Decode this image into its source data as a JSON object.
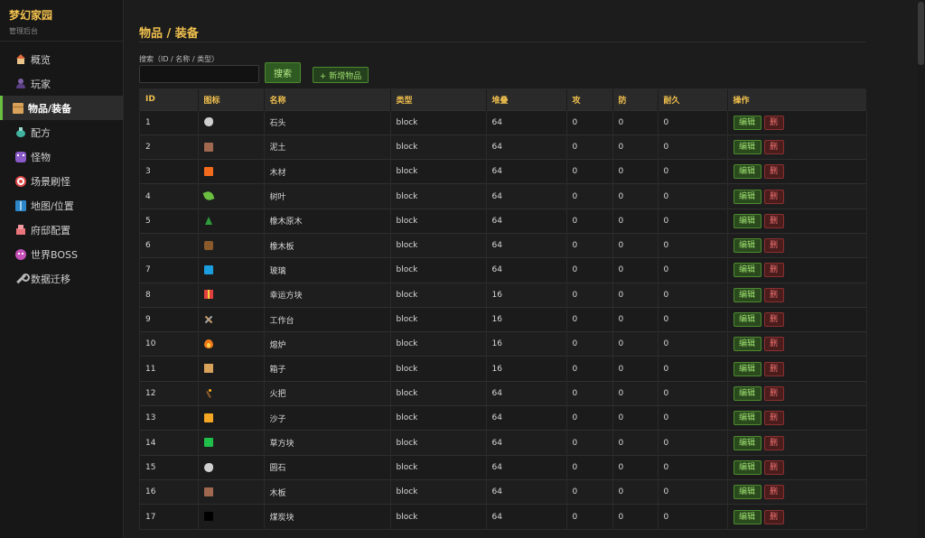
{
  "brand": {
    "title": "梦幻家园",
    "subtitle": "管理后台"
  },
  "sidebar": {
    "items": [
      {
        "label": "概览",
        "icon": "house-icon",
        "active": false
      },
      {
        "label": "玩家",
        "icon": "person-icon",
        "active": false
      },
      {
        "label": "物品/装备",
        "icon": "box-icon",
        "active": true
      },
      {
        "label": "配方",
        "icon": "flask-icon",
        "active": false
      },
      {
        "label": "怪物",
        "icon": "monster-icon",
        "active": false
      },
      {
        "label": "场景刷怪",
        "icon": "target-icon",
        "active": false
      },
      {
        "label": "地图/位置",
        "icon": "map-icon",
        "active": false
      },
      {
        "label": "府邸配置",
        "icon": "castle-icon",
        "active": false
      },
      {
        "label": "世界BOSS",
        "icon": "devil-icon",
        "active": false
      },
      {
        "label": "数据迁移",
        "icon": "wrench-icon",
        "active": false
      }
    ]
  },
  "main": {
    "title": "物品 / 装备",
    "search": {
      "label": "搜索（ID / 名称 / 类型）",
      "value": "",
      "placeholder": "",
      "button": "搜索"
    },
    "add_button": "+ 新增物品"
  },
  "table": {
    "headers": [
      "ID",
      "图标",
      "名称",
      "类型",
      "堆叠",
      "攻",
      "防",
      "耐久",
      "操作"
    ],
    "edit_label": "编辑",
    "delete_label": "删",
    "rows": [
      {
        "id": "1",
        "icon": "rock",
        "color": "#cfcfcf",
        "name": "石头",
        "type": "block",
        "stack": "64",
        "atk": "0",
        "def": "0",
        "dur": "0"
      },
      {
        "id": "2",
        "icon": "swatch",
        "color": "#a0684f",
        "name": "泥土",
        "type": "block",
        "stack": "64",
        "atk": "0",
        "def": "0",
        "dur": "0"
      },
      {
        "id": "3",
        "icon": "swatch",
        "color": "#f26b1d",
        "name": "木材",
        "type": "block",
        "stack": "64",
        "atk": "0",
        "def": "0",
        "dur": "0"
      },
      {
        "id": "4",
        "icon": "leaf",
        "color": "#6abf40",
        "name": "树叶",
        "type": "block",
        "stack": "64",
        "atk": "0",
        "def": "0",
        "dur": "0"
      },
      {
        "id": "5",
        "icon": "tree",
        "color": "#2e9c3a",
        "name": "橡木原木",
        "type": "block",
        "stack": "64",
        "atk": "0",
        "def": "0",
        "dur": "0"
      },
      {
        "id": "6",
        "icon": "wood",
        "color": "#8b5a2b",
        "name": "橡木板",
        "type": "block",
        "stack": "64",
        "atk": "0",
        "def": "0",
        "dur": "0"
      },
      {
        "id": "7",
        "icon": "swatch",
        "color": "#1a9ee0",
        "name": "玻璃",
        "type": "block",
        "stack": "64",
        "atk": "0",
        "def": "0",
        "dur": "0"
      },
      {
        "id": "8",
        "icon": "gift",
        "color": "#e23f3f",
        "name": "幸运方块",
        "type": "block",
        "stack": "16",
        "atk": "0",
        "def": "0",
        "dur": "0"
      },
      {
        "id": "9",
        "icon": "tools",
        "color": "#aaaaaa",
        "name": "工作台",
        "type": "block",
        "stack": "16",
        "atk": "0",
        "def": "0",
        "dur": "0"
      },
      {
        "id": "10",
        "icon": "fire",
        "color": "#f07a1a",
        "name": "熔炉",
        "type": "block",
        "stack": "16",
        "atk": "0",
        "def": "0",
        "dur": "0"
      },
      {
        "id": "11",
        "icon": "chest",
        "color": "#d9a25a",
        "name": "箱子",
        "type": "block",
        "stack": "16",
        "atk": "0",
        "def": "0",
        "dur": "0"
      },
      {
        "id": "12",
        "icon": "torch",
        "color": "#ffb020",
        "name": "火把",
        "type": "block",
        "stack": "64",
        "atk": "0",
        "def": "0",
        "dur": "0"
      },
      {
        "id": "13",
        "icon": "swatch",
        "color": "#f5a623",
        "name": "沙子",
        "type": "block",
        "stack": "64",
        "atk": "0",
        "def": "0",
        "dur": "0"
      },
      {
        "id": "14",
        "icon": "swatch",
        "color": "#1fbf4a",
        "name": "草方块",
        "type": "block",
        "stack": "64",
        "atk": "0",
        "def": "0",
        "dur": "0"
      },
      {
        "id": "15",
        "icon": "rock",
        "color": "#cfcfcf",
        "name": "圆石",
        "type": "block",
        "stack": "64",
        "atk": "0",
        "def": "0",
        "dur": "0"
      },
      {
        "id": "16",
        "icon": "swatch",
        "color": "#a0684f",
        "name": "木板",
        "type": "block",
        "stack": "64",
        "atk": "0",
        "def": "0",
        "dur": "0"
      },
      {
        "id": "17",
        "icon": "swatch",
        "color": "#000000",
        "name": "煤炭块",
        "type": "block",
        "stack": "64",
        "atk": "0",
        "def": "0",
        "dur": "0"
      }
    ]
  },
  "colors": {
    "accent": "#f2c14e",
    "primary_green": "#6abf40",
    "danger_red": "#e04848",
    "bg": "#1c1c1c"
  }
}
